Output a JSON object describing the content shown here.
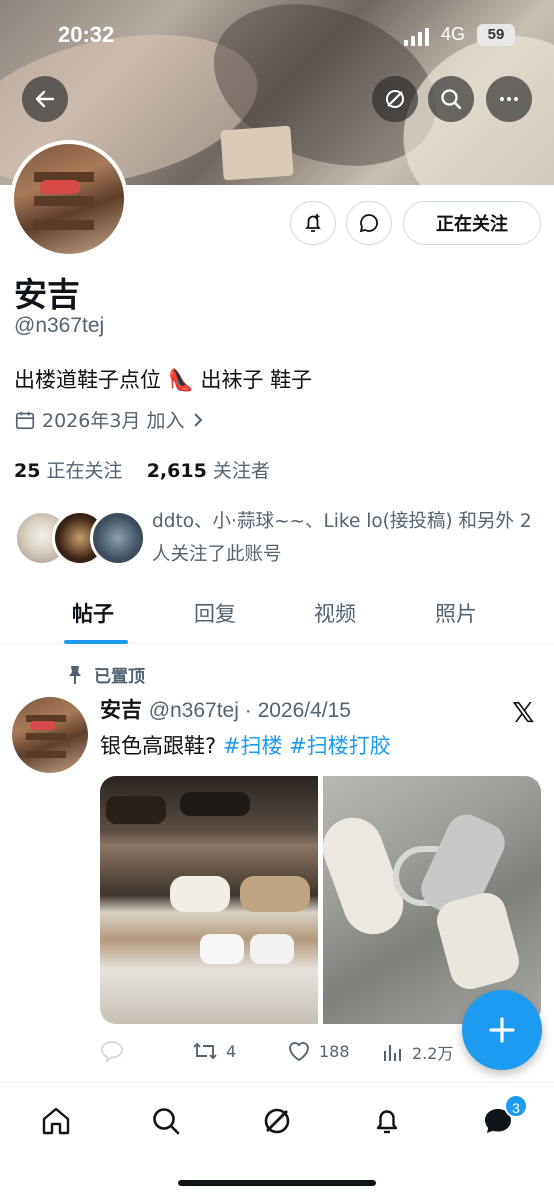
{
  "status_bar": {
    "time": "20:32",
    "network": "4G",
    "battery": "59"
  },
  "profile": {
    "name": "安吉",
    "handle": "@n367tej",
    "bio": "出楼道鞋子点位 👠 出袜子 鞋子",
    "joined": "2026年3月 加入",
    "following_count": "25",
    "following_label": "正在关注",
    "followers_count": "2,615",
    "followers_label": "关注者",
    "follow_button": "正在关注",
    "mutuals_text": "ddto、小·蒜球~~、Like lo(接投稿) 和另外 2 人关注了此账号"
  },
  "tabs": [
    {
      "label": "帖子"
    },
    {
      "label": "回复"
    },
    {
      "label": "视频"
    },
    {
      "label": "照片"
    }
  ],
  "post": {
    "pinned_label": "已置顶",
    "author_name": "安吉",
    "author_meta": "@n367tej · 2026/4/15",
    "text": "银色高跟鞋?",
    "tags": [
      "#扫楼",
      "#扫楼打胶"
    ],
    "retweets": "4",
    "likes": "188",
    "views": "2.2万"
  },
  "bottom_nav": {
    "messages_badge": "3"
  },
  "colors": {
    "accent": "#1d9bf0",
    "text": "#0f1419",
    "secondary": "#536471"
  }
}
